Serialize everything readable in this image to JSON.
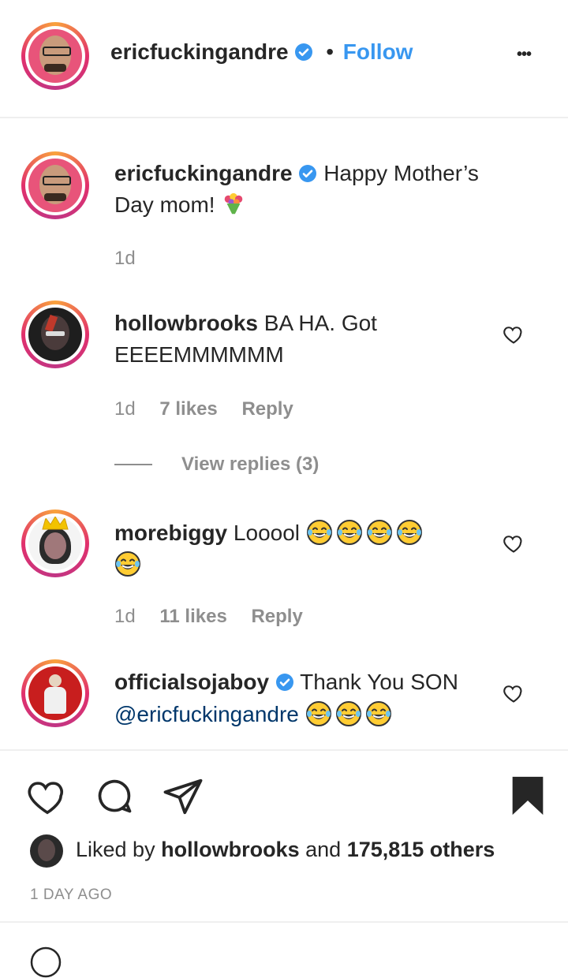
{
  "header": {
    "username": "ericfuckingandre",
    "dot": "•",
    "follow_label": "Follow",
    "more_label": "•••"
  },
  "caption": {
    "username": "ericfuckingandre",
    "text_line1": "Happy Mother’s",
    "text_line2": "Day mom!",
    "time": "1d"
  },
  "comments": [
    {
      "username": "hollowbrooks",
      "text_line1": "BA HA. Got",
      "text_line2": "EEEEMMMMMM",
      "time": "1d",
      "likes": "7 likes",
      "reply": "Reply",
      "view_replies": "View replies (3)"
    },
    {
      "username": "morebiggy",
      "text_line1": "Looool",
      "time": "1d",
      "likes": "11 likes",
      "reply": "Reply"
    },
    {
      "username": "officialsojaboy",
      "text_line1": "Thank You SON",
      "mention": "@ericfuckingandre"
    }
  ],
  "actions": {
    "liked_by_prefix": "Liked by",
    "liked_by_user": "hollowbrooks",
    "liked_by_suffix": "and",
    "others": "175,815 others",
    "date": "1 DAY AGO"
  },
  "colors": {
    "link": "#3897f0",
    "verified": "#3897f0",
    "muted": "#8e8e8e",
    "text": "#262626"
  },
  "icons": [
    "verified-badge-icon",
    "heart-icon",
    "comment-icon",
    "share-icon",
    "bookmark-icon",
    "bouquet-emoji-icon",
    "tears-of-joy-emoji-icon"
  ]
}
